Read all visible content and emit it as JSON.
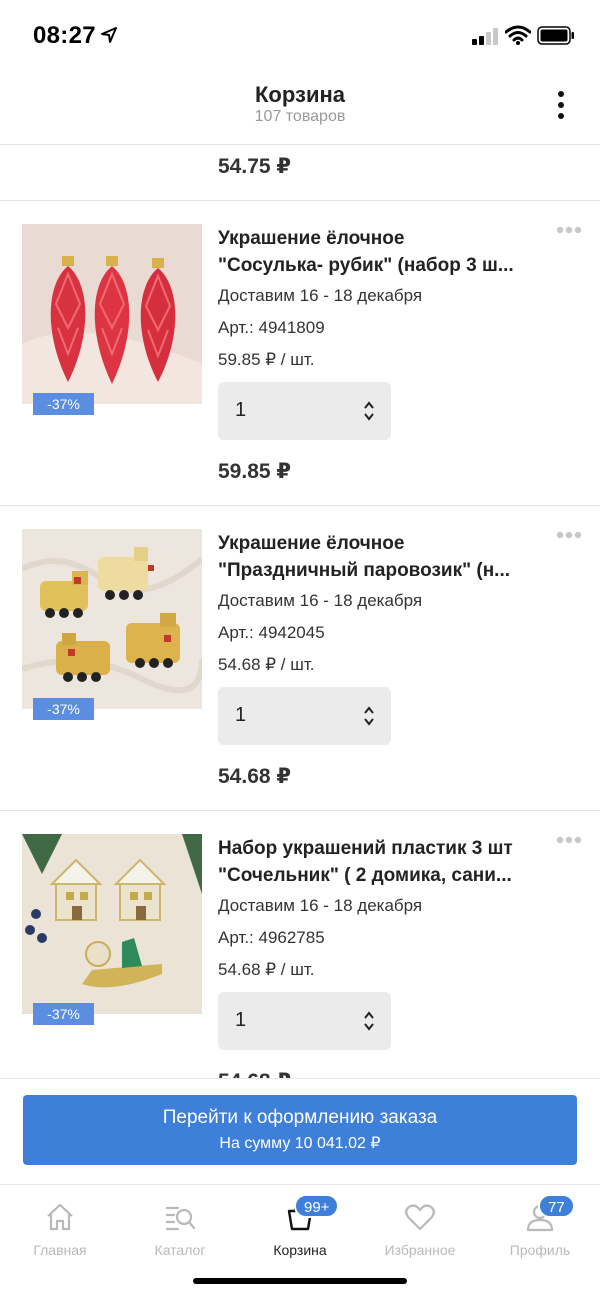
{
  "status": {
    "time": "08:27"
  },
  "header": {
    "title": "Корзина",
    "subtitle": "107 товаров"
  },
  "prev_item": {
    "total": "54.75 ₽"
  },
  "items": [
    {
      "name_line1": "Украшение ёлочное",
      "name_line2": "\"Сосулька- рубик\" (набор 3 ш...",
      "delivery": "Доставим 16 - 18 декабря",
      "article": "Арт.: 4941809",
      "unit_price": "59.85 ₽ / шт.",
      "quantity": "1",
      "total": "59.85 ₽",
      "discount": "-37%",
      "image": "red-icicle-ornaments"
    },
    {
      "name_line1": "Украшение ёлочное",
      "name_line2": "\"Праздничный паровозик\" (н...",
      "delivery": "Доставим 16 - 18 декабря",
      "article": "Арт.: 4942045",
      "unit_price": "54.68 ₽ / шт.",
      "quantity": "1",
      "total": "54.68 ₽",
      "discount": "-37%",
      "image": "gold-train-ornaments"
    },
    {
      "name_line1": "Набор украшений пластик 3 шт",
      "name_line2": "\"Сочельник\" ( 2 домика, сани...",
      "delivery": "Доставим 16 - 18 декабря",
      "article": "Арт.: 4962785",
      "unit_price": "54.68 ₽ / шт.",
      "quantity": "1",
      "total": "54.68 ₽",
      "discount": "-37%",
      "image": "house-sleigh-ornaments"
    }
  ],
  "checkout": {
    "label": "Перейти к оформлению заказа",
    "sum": "На сумму 10 041.02 ₽"
  },
  "tabs": [
    {
      "label": "Главная",
      "icon": "home-icon"
    },
    {
      "label": "Каталог",
      "icon": "catalog-search-icon"
    },
    {
      "label": "Корзина",
      "icon": "cart-icon",
      "badge": "99+",
      "active": true
    },
    {
      "label": "Избранное",
      "icon": "heart-icon"
    },
    {
      "label": "Профиль",
      "icon": "profile-icon",
      "badge": "77"
    }
  ],
  "colors": {
    "accent": "#3d7fd9",
    "discount": "#5b8ee0",
    "inactive_tab": "#b9b9b9"
  }
}
